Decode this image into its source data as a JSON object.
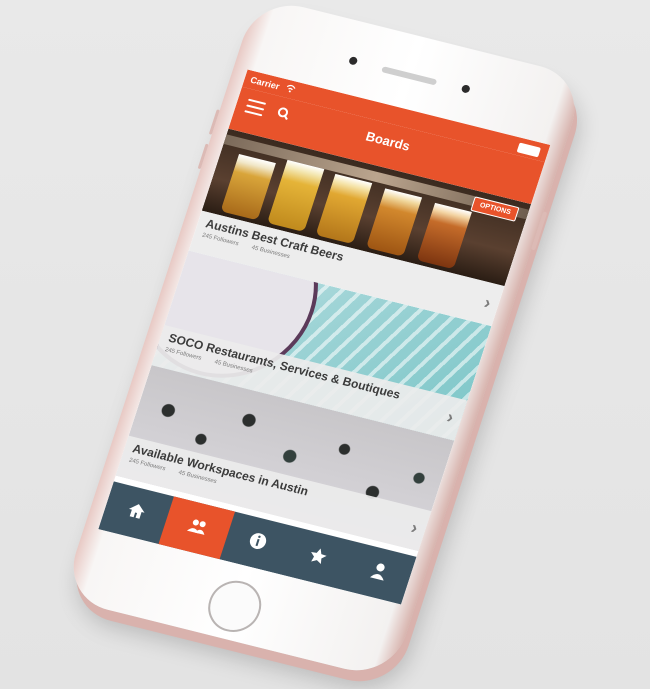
{
  "status_bar": {
    "carrier": "Carrier",
    "wifi_icon": "wifi-icon"
  },
  "header": {
    "title": "Boards",
    "options_label": "OPTIONS"
  },
  "boards": [
    {
      "title": "Austins Best Craft Beers",
      "followers": "245 Followers",
      "businesses": "45 Businesses"
    },
    {
      "title": "SOCO Restaurants, Services & Boutiques",
      "followers": "245 Followers",
      "businesses": "45 Businesses"
    },
    {
      "title": "Available Workspaces in Austin",
      "followers": "245 Followers",
      "businesses": "45 Businesses"
    }
  ],
  "tab_bar": {
    "active_index": 1,
    "icons": [
      "home-icon",
      "people-icon",
      "info-icon",
      "star-icon",
      "user-icon"
    ]
  },
  "colors": {
    "accent": "#e8532b",
    "tab_bar": "#3d5463",
    "phone": "#f8f6f5",
    "phone_edge": "#d9b2ad"
  }
}
